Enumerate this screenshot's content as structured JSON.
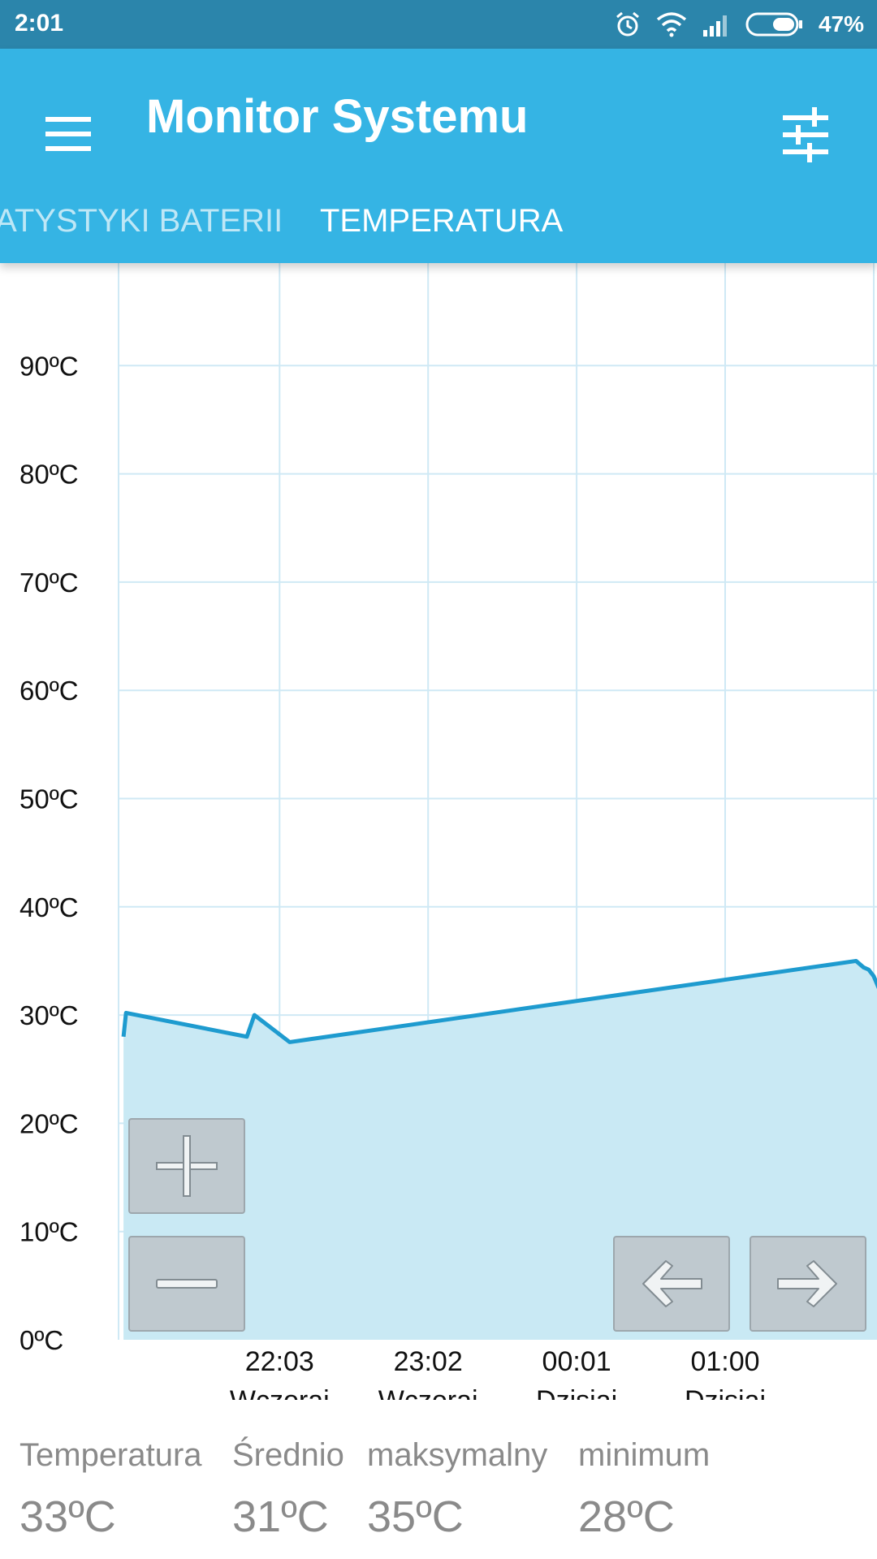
{
  "status_bar": {
    "time": "2:01",
    "battery_percent": "47%",
    "icons": [
      "alarm-icon",
      "wifi-icon",
      "signal-icon",
      "battery-icon"
    ]
  },
  "app_bar": {
    "title": "Monitor Systemu",
    "menu_icon": "hamburger-menu-icon",
    "settings_icon": "sliders-icon",
    "background_color": "#35b4e4"
  },
  "tabs": [
    {
      "label": "STATYSTYKI BATERII",
      "active": false
    },
    {
      "label": "TEMPERATURA",
      "active": true
    }
  ],
  "chart_data": {
    "type": "area",
    "y_tick_labels": [
      "0ºC",
      "10ºC",
      "20ºC",
      "30ºC",
      "40ºC",
      "50ºC",
      "60ºC",
      "70ºC",
      "80ºC",
      "90ºC"
    ],
    "ylim": [
      0,
      100
    ],
    "x_tick_labels": [
      {
        "time": "22:03",
        "day": "Wczoraj"
      },
      {
        "time": "23:02",
        "day": "Wczoraj"
      },
      {
        "time": "00:01",
        "day": "Dzisiaj"
      },
      {
        "time": "01:00",
        "day": "Dzisiaj"
      }
    ],
    "series": [
      {
        "x": [
          "21:01",
          "21:02",
          "21:50",
          "21:53",
          "22:07",
          "01:52",
          "01:55",
          "01:57",
          "01:59",
          "02:01"
        ],
        "y": [
          28.0,
          30.2,
          28.0,
          30.0,
          27.5,
          35.0,
          34.4,
          34.2,
          33.6,
          32.5
        ]
      }
    ],
    "grid": true,
    "line_color": "#1e9bcf",
    "fill_color": "#c9e9f4"
  },
  "controls": {
    "zoom_in_icon": "plus-icon",
    "zoom_out_icon": "minus-icon",
    "prev_icon": "arrow-left-icon",
    "next_icon": "arrow-right-icon"
  },
  "stats": [
    {
      "label": "Temperatura",
      "value": "33ºC"
    },
    {
      "label": "Średnio",
      "value": "31ºC"
    },
    {
      "label": "maksymalny",
      "value": "35ºC"
    },
    {
      "label": "minimum",
      "value": "28ºC"
    }
  ]
}
